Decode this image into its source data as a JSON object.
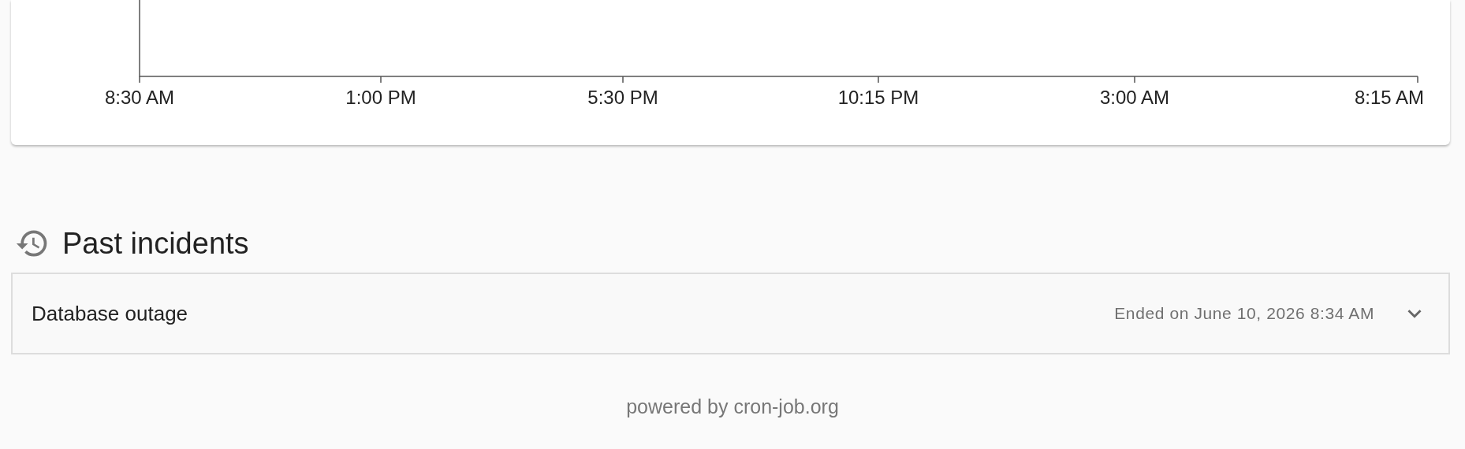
{
  "chart": {
    "x_axis_labels": [
      "8:30 AM",
      "1:00 PM",
      "5:30 PM",
      "10:15 PM",
      "3:00 AM",
      "8:15 AM"
    ]
  },
  "past_incidents": {
    "title": "Past incidents",
    "items": [
      {
        "title": "Database outage",
        "ended": "Ended on June 10, 2026 8:34 AM",
        "expanded": false
      }
    ]
  },
  "footer": "powered by cron-job.org"
}
